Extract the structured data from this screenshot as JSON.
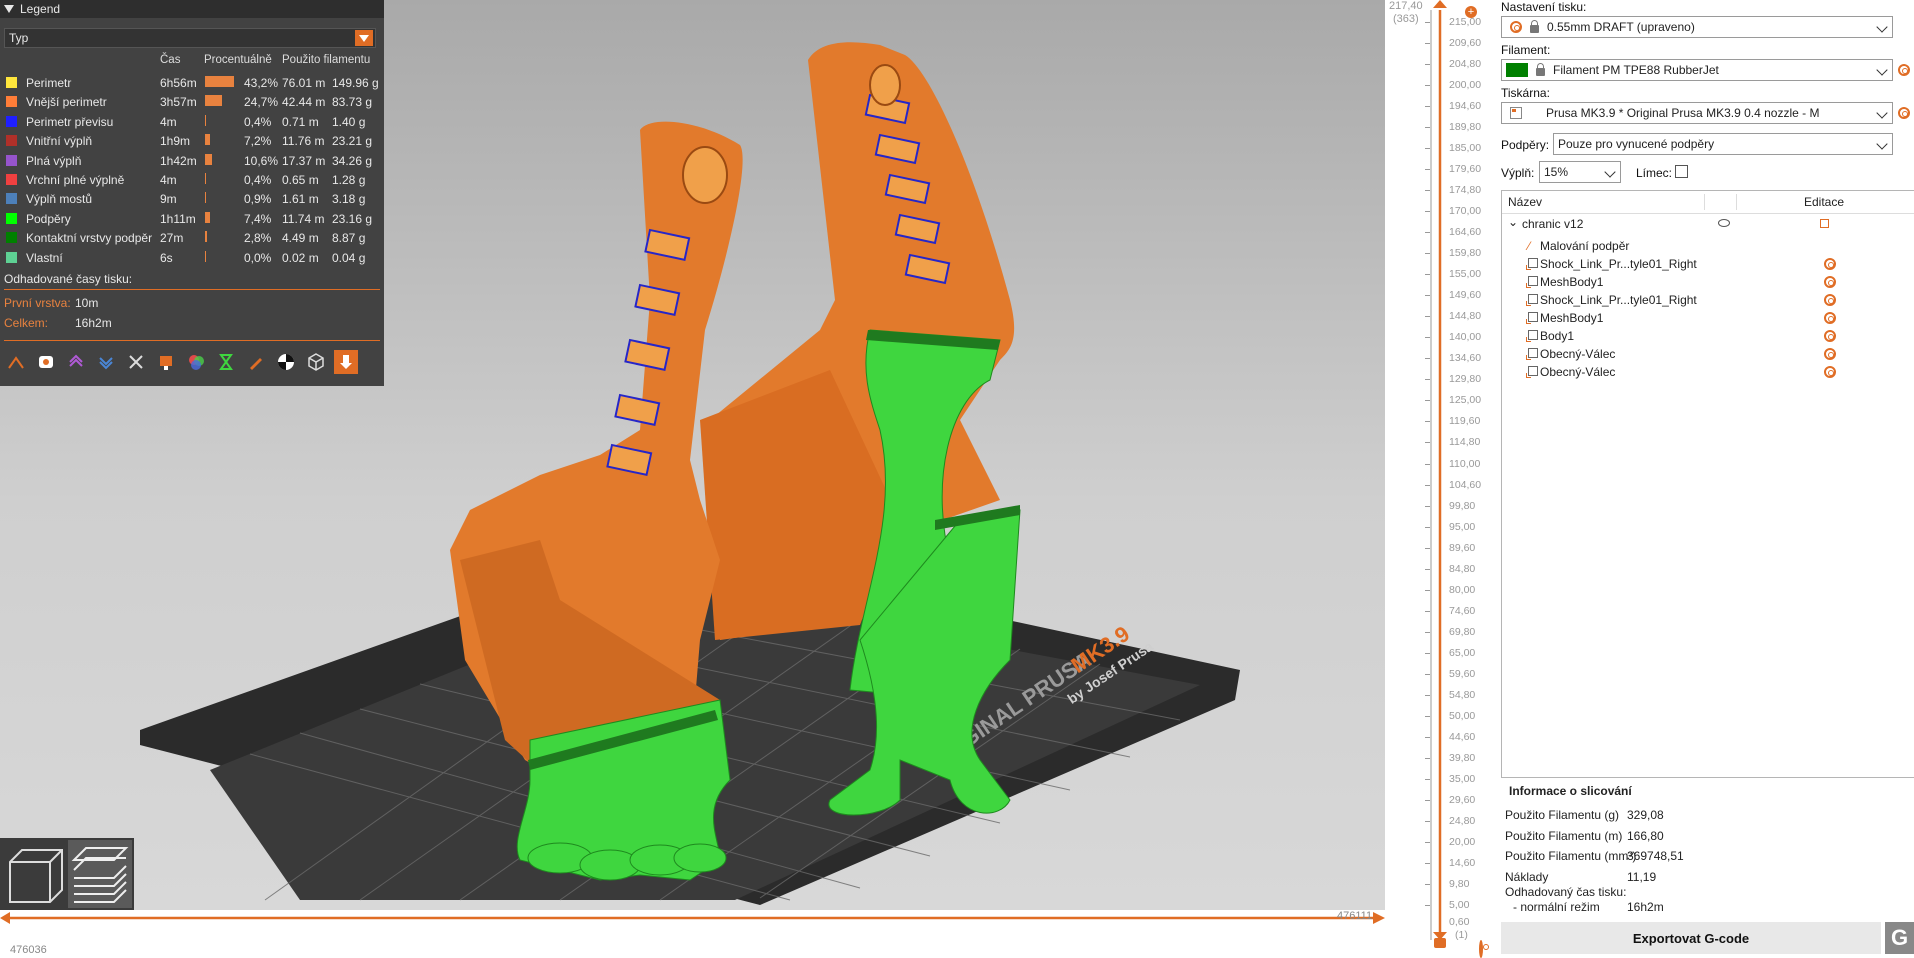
{
  "legend": {
    "title": "Legend",
    "view_type": "Typ",
    "columns": {
      "time": "Čas",
      "percent": "Procentuálně",
      "filament": "Použito filamentu"
    },
    "items": [
      {
        "label": "Perimetr",
        "color": "#ffe63c",
        "time": "6h56m",
        "percent": "43,2%",
        "ratio": 0.432,
        "length": "76.01 m",
        "weight": "149.96 g"
      },
      {
        "label": "Vnější perimetr",
        "color": "#ff7d38",
        "time": "3h57m",
        "percent": "24,7%",
        "ratio": 0.247,
        "length": "42.44 m",
        "weight": "83.73 g"
      },
      {
        "label": "Perimetr převisu",
        "color": "#1f1fff",
        "time": "4m",
        "percent": "0,4%",
        "ratio": 0.004,
        "length": "0.71 m",
        "weight": "1.40 g"
      },
      {
        "label": "Vnitřní výplň",
        "color": "#b03029",
        "time": "1h9m",
        "percent": "7,2%",
        "ratio": 0.072,
        "length": "11.76 m",
        "weight": "23.21 g"
      },
      {
        "label": "Plná výplň",
        "color": "#9654cc",
        "time": "1h42m",
        "percent": "10,6%",
        "ratio": 0.106,
        "length": "17.37 m",
        "weight": "34.26 g"
      },
      {
        "label": "Vrchní plné výplně",
        "color": "#f04040",
        "time": "4m",
        "percent": "0,4%",
        "ratio": 0.004,
        "length": "0.65 m",
        "weight": "1.28 g"
      },
      {
        "label": "Výplň mostů",
        "color": "#4d80ba",
        "time": "9m",
        "percent": "0,9%",
        "ratio": 0.009,
        "length": "1.61 m",
        "weight": "3.18 g"
      },
      {
        "label": "Podpěry",
        "color": "#00ff00",
        "time": "1h11m",
        "percent": "7,4%",
        "ratio": 0.074,
        "length": "11.74 m",
        "weight": "23.16 g"
      },
      {
        "label": "Kontaktní vrstvy podpěr",
        "color": "#008000",
        "time": "27m",
        "percent": "2,8%",
        "ratio": 0.028,
        "length": "4.49 m",
        "weight": "8.87 g"
      },
      {
        "label": "Vlastní",
        "color": "#5ed194",
        "time": "6s",
        "percent": "0,0%",
        "ratio": 0.0,
        "length": "0.02 m",
        "weight": "0.04 g"
      }
    ],
    "estimated_title": "Odhadované časy tisku:",
    "first_layer_label": "První vrstva:",
    "first_layer_value": "10m",
    "total_label": "Celkem:",
    "total_value": "16h2m"
  },
  "bed": {
    "brand_text": "ORIGINAL PRUSA",
    "model_text": "MK3.9",
    "byline": "by Josef Prusa"
  },
  "horizontal_slider": {
    "left_value": "476036",
    "right_value": "476111"
  },
  "vertical_slider": {
    "top_value": "217,40",
    "top_layer": "(363)",
    "bottom_value": "0,60",
    "bottom_layer": "(1)",
    "ticks": [
      "215,00",
      "209,60",
      "204,80",
      "200,00",
      "194,60",
      "189,80",
      "185,00",
      "179,60",
      "174,80",
      "170,00",
      "164,60",
      "159,80",
      "155,00",
      "149,60",
      "144,80",
      "140,00",
      "134,60",
      "129,80",
      "125,00",
      "119,60",
      "114,80",
      "110,00",
      "104,60",
      "99,80",
      "95,00",
      "89,60",
      "84,80",
      "80,00",
      "74,60",
      "69,80",
      "65,00",
      "59,60",
      "54,80",
      "50,00",
      "44,60",
      "39,80",
      "35,00",
      "29,60",
      "24,80",
      "20,00",
      "14,60",
      "9,80",
      "5,00"
    ]
  },
  "panel": {
    "print_settings_label": "Nastavení tisku:",
    "print_settings_value": "0.55mm DRAFT (upraveno)",
    "filament_label": "Filament:",
    "filament_value": "Filament PM TPE88 RubberJet",
    "filament_color": "#008000",
    "printer_label": "Tiskárna:",
    "printer_value": "Prusa MK3.9 * Original Prusa MK3.9 0.4 nozzle - M",
    "supports_label": "Podpěry:",
    "supports_value": "Pouze pro vynucené podpěry",
    "infill_label": "Výplň:",
    "infill_value": "15%",
    "brim_label": "Límec:",
    "tree": {
      "col_name": "Název",
      "col_edit": "Editace",
      "root": "chranic v12",
      "items": [
        {
          "label": "Malování podpěr",
          "kind": "paint"
        },
        {
          "label": "Shock_Link_Pr...tyle01_Right",
          "kind": "part"
        },
        {
          "label": "MeshBody1",
          "kind": "part"
        },
        {
          "label": "Shock_Link_Pr...tyle01_Right",
          "kind": "part"
        },
        {
          "label": "MeshBody1",
          "kind": "part"
        },
        {
          "label": "Body1",
          "kind": "part"
        },
        {
          "label": "Obecný-Válec",
          "kind": "part"
        },
        {
          "label": "Obecný-Válec",
          "kind": "part"
        }
      ]
    },
    "slice_info": {
      "title": "Informace o slicování",
      "rows": [
        {
          "label": "Použito Filamentu (g)",
          "value": "329,08"
        },
        {
          "label": "Použito Filamentu (m)",
          "value": "166,80"
        },
        {
          "label": "Použito Filamentu (mm³)",
          "value": "369748,51"
        },
        {
          "label": "Náklady",
          "value": "11,19"
        }
      ],
      "est_label": "Odhadovaný čas tisku:",
      "mode_label": "- normální režim",
      "mode_value": "16h2m"
    },
    "export_label": "Exportovat G-code",
    "gcode_icon_text": "G"
  }
}
